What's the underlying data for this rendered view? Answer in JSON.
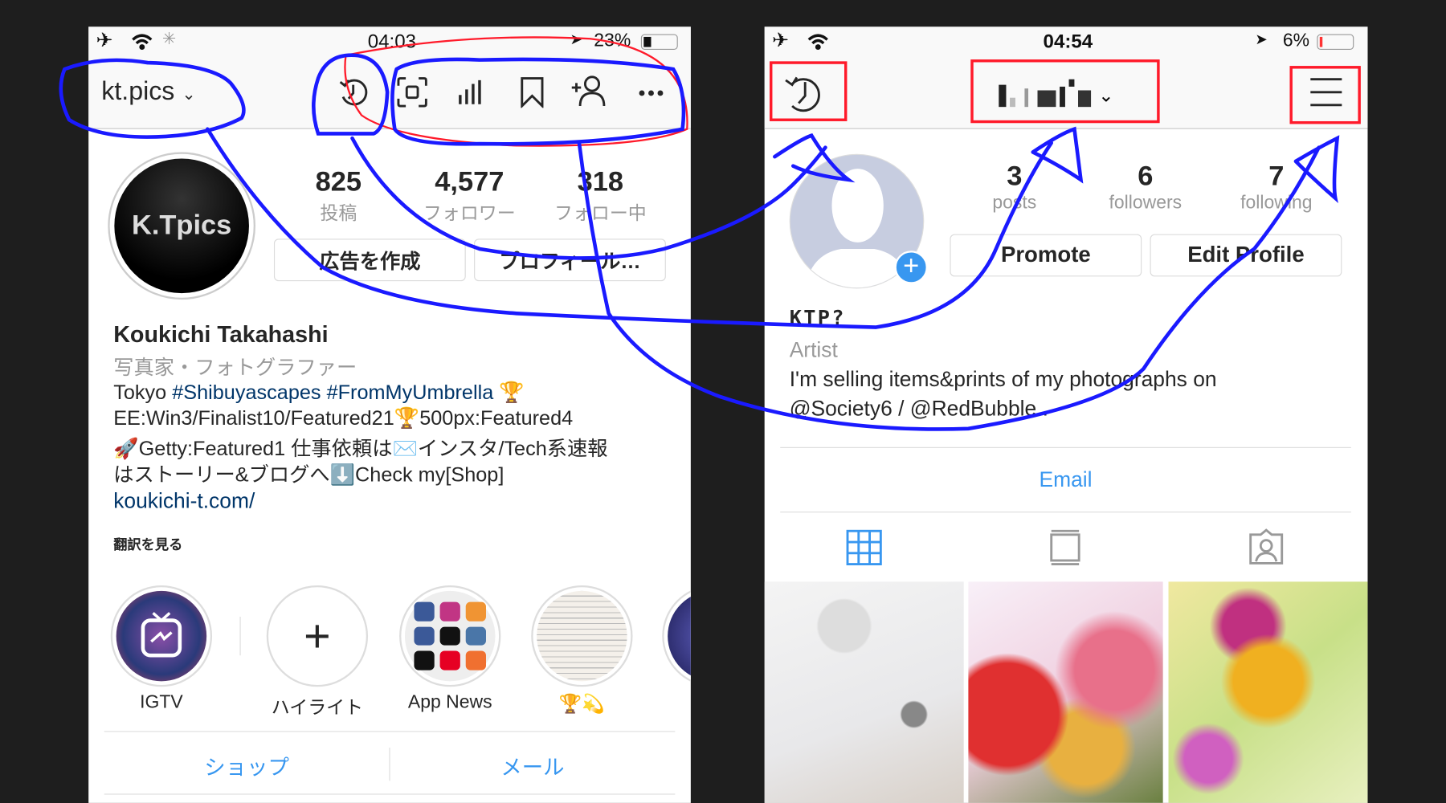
{
  "left_phone": {
    "status": {
      "time": "04:03",
      "battery": "23%",
      "battery_level": 0.23
    },
    "header": {
      "username": "kt.pics",
      "icons": [
        "history-icon",
        "scan-icon",
        "insights-icon",
        "bookmark-icon",
        "add-person-icon",
        "more-icon"
      ]
    },
    "avatar_text": "K.Tpics",
    "stats": [
      {
        "value": "825",
        "label": "投稿"
      },
      {
        "value": "4,577",
        "label": "フォロワー"
      },
      {
        "value": "318",
        "label": "フォロー中"
      }
    ],
    "buttons": {
      "create_ad": "広告を作成",
      "profile": "プロフィール…"
    },
    "name": "Koukichi Takahashi",
    "category": "写真家・フォトグラファー",
    "bio": {
      "line1_prefix": "Tokyo ",
      "hashtags": "#Shibuyascapes #FromMyUmbrella",
      "line1_suffix": " 🏆",
      "line2": "EE:Win3/Finalist10/Featured21🏆500px:Featured4",
      "line3": "🚀Getty:Featured1 仕事依頼は✉️インスタ/Tech系速報",
      "line4": "はストーリー&ブログへ⬇️Check my[Shop]"
    },
    "link": "koukichi-t.com/",
    "translate": "翻訳を見る",
    "highlights": [
      {
        "label": "IGTV"
      },
      {
        "label": "ハイライト"
      },
      {
        "label": "App News"
      },
      {
        "label": "🏆💫"
      },
      {
        "label": "📸"
      }
    ],
    "bottom_tabs": {
      "shop": "ショップ",
      "mail": "メール"
    }
  },
  "right_phone": {
    "status": {
      "time": "04:54",
      "battery": "6%",
      "battery_level": 0.06
    },
    "header": {
      "username": "(pixelated)",
      "icons": [
        "history-icon",
        "menu-icon"
      ]
    },
    "stats": [
      {
        "value": "3",
        "label": "posts"
      },
      {
        "value": "6",
        "label": "followers"
      },
      {
        "value": "7",
        "label": "following"
      }
    ],
    "buttons": {
      "promote": "Promote",
      "edit_profile": "Edit Profile"
    },
    "name": "KTP?",
    "category": "Artist",
    "bio": {
      "line1": "I'm selling items&prints of my photographs on",
      "line2": "@Society6 / @RedBubble ."
    },
    "email": "Email",
    "tabs": [
      "grid-icon",
      "feed-icon",
      "tagged-icon"
    ]
  },
  "colors": {
    "link_blue": "#3897f0",
    "annotation_blue": "#1a1aff",
    "annotation_red": "#ff0000"
  }
}
